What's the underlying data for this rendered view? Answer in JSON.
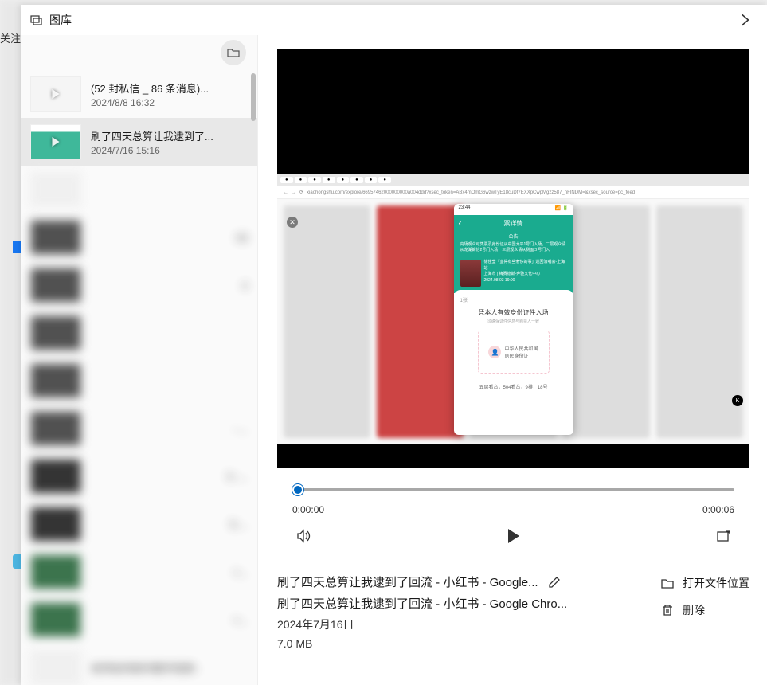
{
  "bg": {
    "tab_text": "关注"
  },
  "window": {
    "title": "图库"
  },
  "sidebar": {
    "items": [
      {
        "title": "(52 封私信 _ 86 条消息)...",
        "date": "2024/8/8 16:32"
      },
      {
        "title": "刷了四天总算让我逮到了...",
        "date": "2024/7/16 15:16"
      }
    ],
    "blurred": [
      {
        "suffix": ""
      },
      {
        "suffix": "03"
      },
      {
        "suffix": "4"
      },
      {
        "suffix": ""
      },
      {
        "suffix": ""
      },
      {
        "suffix": "- ..."
      },
      {
        "suffix": "5 -..."
      },
      {
        "suffix": "5-..."
      },
      {
        "suffix": "<..."
      },
      {
        "suffix": "<..."
      },
      {
        "suffix": "老师如何制作教学视频 -"
      }
    ]
  },
  "video": {
    "current_time": "0:00:00",
    "duration": "0:00:06",
    "sim": {
      "url": "xiaohongshu.com/explore/66957462000000000a004ddd?xsec_token=ABx4mOmG6wzwTyE18cuDf7EXXpCwpMgzz587_nFINDM=&xsec_source=pc_feed",
      "phone_time": "23:44",
      "header": "票详情",
      "notice_title": "公告",
      "notice_body": "内场观众可凭票及身份证从中国太平1号门入场，二层观众请从龙湖朗怡2号门入场，三层观众请从侧面３号门入",
      "event_title": "徐佳莹「宜得有些奢侈的事」巡回演唱会-上海站",
      "event_venue": "上海市 | 梅赛德斯-奔驰文化中心",
      "event_time": "2024.08.03 19:00",
      "card_num": "1张",
      "card_main": "凭本人有效身份证件入场",
      "card_sub": "须确保证件信息与购票人一致",
      "id_label": "中华人民共和国",
      "id_label2": "居民身份证",
      "seat": "五层看台，504看台，9排，18号"
    }
  },
  "meta": {
    "title": "刷了四天总算让我逮到了回流 - 小红书 - Google...",
    "app_line": "刷了四天总算让我逮到了回流 - 小红书 - Google Chro...",
    "date": "2024年7月16日",
    "size": "7.0 MB"
  },
  "actions": {
    "open_location": "打开文件位置",
    "delete": "删除"
  }
}
